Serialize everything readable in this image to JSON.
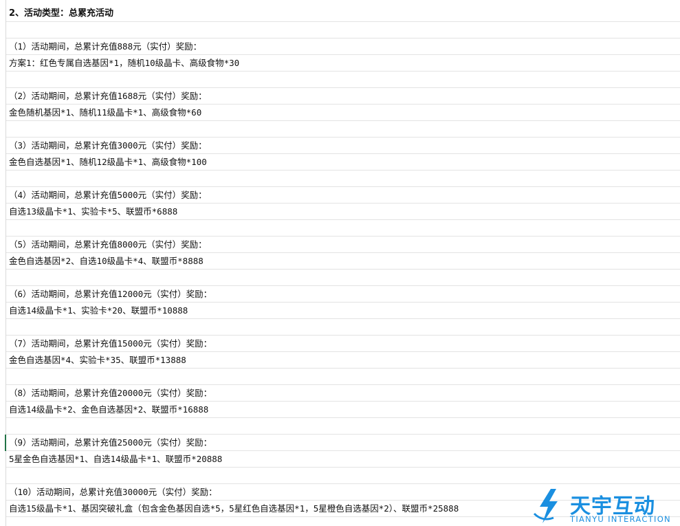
{
  "rows": [
    "2、活动类型：总累充活动",
    "",
    "（1）活动期间，总累计充值888元（实付）奖励：",
    "方案1：红色专属自选基因*1，随机10级晶卡、高级食物*30",
    "",
    "（2）活动期间，总累计充值1688元（实付）奖励：",
    "金色随机基因*1、随机11级晶卡*1、高级食物*60",
    "",
    "（3）活动期间，总累计充值3000元（实付）奖励：",
    "金色自选基因*1、随机12级晶卡*1、高级食物*100",
    "",
    "（4）活动期间，总累计充值5000元（实付）奖励：",
    "自选13级晶卡*1、实验卡*5、联盟币*6888",
    "",
    "（5）活动期间，总累计充值8000元（实付）奖励：",
    "金色自选基因*2、自选10级晶卡*4、联盟币*8888",
    "",
    "（6）活动期间，总累计充值12000元（实付）奖励：",
    "自选14级晶卡*1、实验卡*20、联盟币*10888",
    "",
    "（7）活动期间，总累计充值15000元（实付）奖励：",
    "金色自选基因*4、实验卡*35、联盟币*13888",
    "",
    "（8）活动期间，总累计充值20000元（实付）奖励：",
    "自选14级晶卡*2、金色自选基因*2、联盟币*16888",
    "",
    "（9）活动期间，总累计充值25000元（实付）奖励：",
    "5星金色自选基因*1、自选14级晶卡*1、联盟币*20888",
    "",
    "（10）活动期间，总累计充值30000元（实付）奖励：",
    "自选15级晶卡*1、基因突破礼盒（包含金色基因自选*5，5星红色自选基因*1，5星橙色自选基因*2）、联盟币*25888"
  ],
  "watermark": {
    "brand": "天宇互动",
    "sub": "TIANYU INTERACTION"
  },
  "colors": {
    "grid": "#e3e3e3",
    "selection": "#217346",
    "watermark": "#1a8fe0"
  }
}
